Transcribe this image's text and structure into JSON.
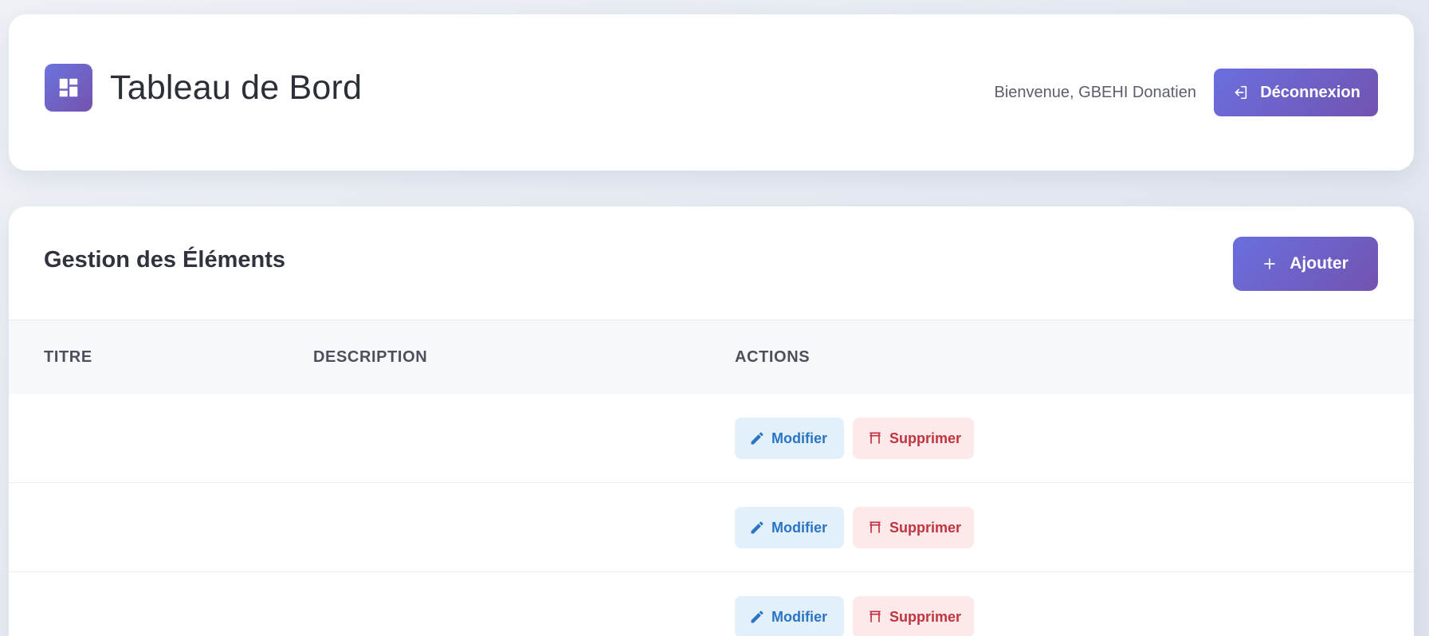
{
  "header": {
    "title": "Tableau de Bord",
    "welcome": "Bienvenue, GBEHI Donatien",
    "logout_label": "Déconnexion",
    "brand_icon": "dashboard-icon"
  },
  "main": {
    "section_title": "Gestion des Éléments",
    "add_label": "Ajouter",
    "columns": [
      "TITRE",
      "DESCRIPTION",
      "ACTIONS"
    ],
    "rows": [
      {
        "title": "",
        "description": "",
        "edit_label": "Modifier",
        "delete_label": "Supprimer"
      },
      {
        "title": "",
        "description": "",
        "edit_label": "Modifier",
        "delete_label": "Supprimer"
      },
      {
        "title": "",
        "description": "",
        "edit_label": "Modifier",
        "delete_label": "Supprimer"
      }
    ]
  },
  "colors": {
    "accent_start": "#6a6fdf",
    "accent_end": "#7253b0",
    "edit_bg": "#e2f0fc",
    "edit_text": "#2a74c4",
    "delete_bg": "#fde8ea",
    "delete_text": "#c0343f"
  }
}
